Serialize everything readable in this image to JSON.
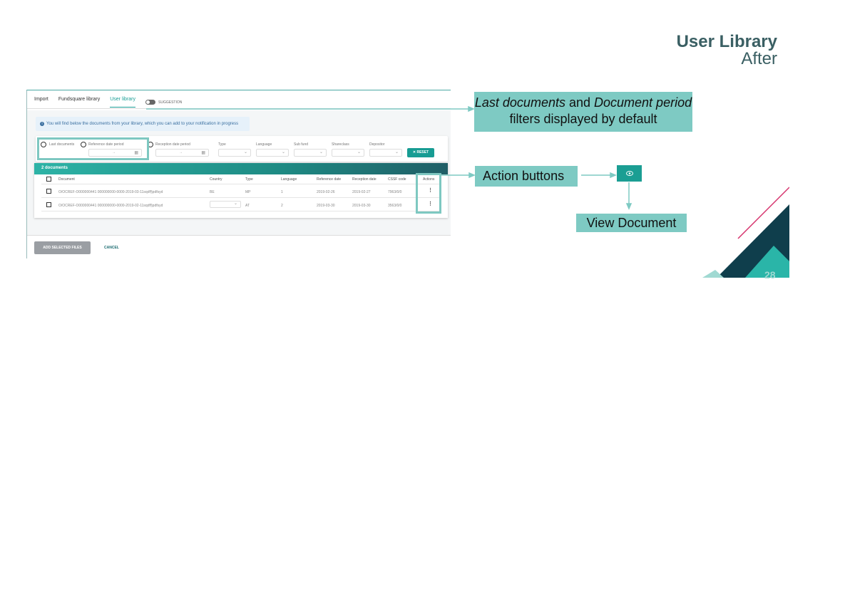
{
  "slide": {
    "title": "User Library",
    "subtitle": "After",
    "page_number": "28"
  },
  "app": {
    "tabs": [
      {
        "label": "Import"
      },
      {
        "label": "Fundsquare library"
      },
      {
        "label": "User library",
        "active": true
      }
    ],
    "suggestion_label": "SUGGESTION",
    "info_text": "You will find below the documents from your library, which you can add to your notification in progress",
    "filters": {
      "last_documents": "Last documents",
      "reference_date_period": "Reference date period",
      "reception_date_period": "Reception date period",
      "type": "Type",
      "language": "Language",
      "sub_fund": "Sub fund",
      "shareclass": "Shareclass",
      "depositor": "Depositor",
      "date_separator": "→",
      "reset_label": "RESET"
    },
    "results": {
      "count_label": "2 documents",
      "columns": [
        "Document",
        "Country",
        "Type",
        "Language",
        "Reference date",
        "Reception date",
        "CSSF code",
        "Actions"
      ],
      "rows": [
        {
          "document": "O/OCREF-O000000441 000000000-0000-2019-03-11sqdf§pdfsyd",
          "country": "BE",
          "type": "MP",
          "language": "1",
          "reference_date": "2019-02-26",
          "reception_date": "2019-02-27",
          "cssf_code": "7963/0/0"
        },
        {
          "document": "O/OCREF-O000000441 000000000-0000-2019-02-11sqdf§pdfsyd",
          "country": "",
          "type": "AT",
          "language": "2",
          "reference_date": "2019-03-30",
          "reception_date": "2019-03-30",
          "cssf_code": "3563/0/0"
        }
      ]
    },
    "footer": {
      "add_selected": "ADD SELECTED FILES",
      "cancel": "CANCEL"
    }
  },
  "callouts": {
    "filters_part1": "Last documents",
    "filters_part2": " and ",
    "filters_part3": "Document period",
    "filters_part4": " filters displayed by default",
    "action_buttons": "Action buttons",
    "view_document": "View Document"
  },
  "colors": {
    "accent": "#179c93",
    "callout": "#7ecac3",
    "title": "#3a5f63",
    "deco_pink": "#d6336c"
  },
  "icons": [
    "toggle-switch",
    "info-icon",
    "calendar-icon",
    "chevron-down-icon",
    "close-icon",
    "kebab-menu-icon",
    "eye-icon"
  ]
}
